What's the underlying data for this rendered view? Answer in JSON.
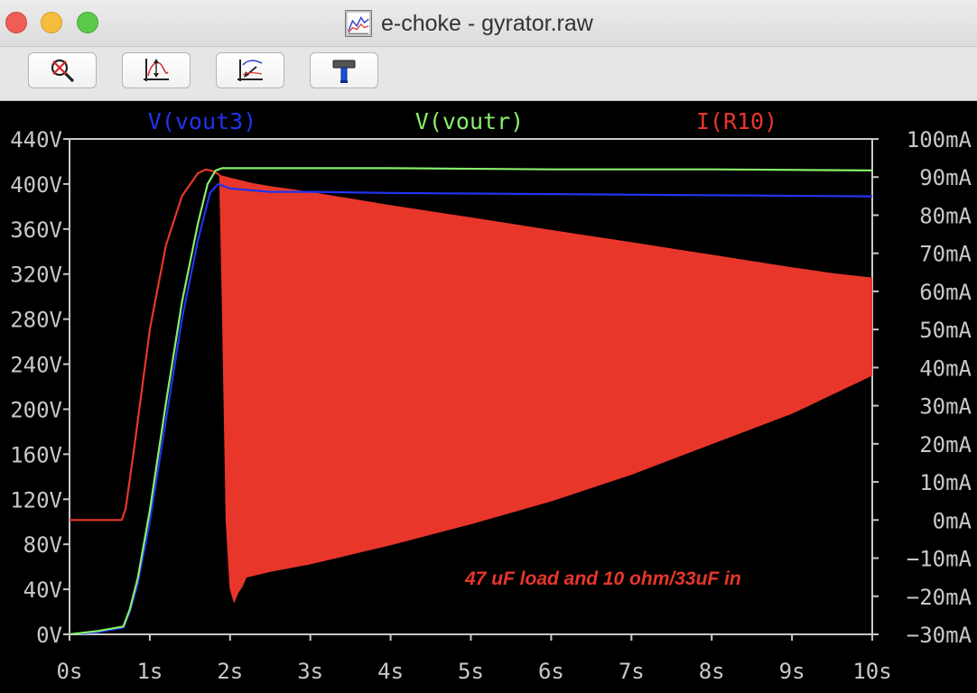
{
  "window": {
    "title": "e-choke - gyrator.raw",
    "icon": "waveform-file-icon"
  },
  "toolbar": {
    "buttons": [
      {
        "name": "zoom-cancel",
        "icon": "magnifier-cross-icon"
      },
      {
        "name": "autorange",
        "icon": "autorange-axes-icon"
      },
      {
        "name": "zoom-back",
        "icon": "zoom-back-arrow-icon"
      },
      {
        "name": "tools",
        "icon": "hammer-icon"
      }
    ]
  },
  "colors": {
    "background": "#000000",
    "axis": "#c8c8c8",
    "vout3": "#2233ee",
    "voutr": "#88f06a",
    "ir10": "#e8362b"
  },
  "chart_data": {
    "type": "line",
    "title": "",
    "xlabel": "",
    "xlim": [
      0,
      10
    ],
    "x_ticks": [
      {
        "v": 0,
        "label": "0s"
      },
      {
        "v": 1,
        "label": "1s"
      },
      {
        "v": 2,
        "label": "2s"
      },
      {
        "v": 3,
        "label": "3s"
      },
      {
        "v": 4,
        "label": "4s"
      },
      {
        "v": 5,
        "label": "5s"
      },
      {
        "v": 6,
        "label": "6s"
      },
      {
        "v": 7,
        "label": "7s"
      },
      {
        "v": 8,
        "label": "8s"
      },
      {
        "v": 9,
        "label": "9s"
      },
      {
        "v": 10,
        "label": "10s"
      }
    ],
    "y_left": {
      "ylim": [
        0,
        440
      ],
      "ticks": [
        {
          "v": 440,
          "label": "440V"
        },
        {
          "v": 400,
          "label": "400V"
        },
        {
          "v": 360,
          "label": "360V"
        },
        {
          "v": 320,
          "label": "320V"
        },
        {
          "v": 280,
          "label": "280V"
        },
        {
          "v": 240,
          "label": "240V"
        },
        {
          "v": 200,
          "label": "200V"
        },
        {
          "v": 160,
          "label": "160V"
        },
        {
          "v": 120,
          "label": "120V"
        },
        {
          "v": 80,
          "label": "80V"
        },
        {
          "v": 40,
          "label": "40V"
        },
        {
          "v": 0,
          "label": "0V"
        }
      ]
    },
    "y_right": {
      "ylim": [
        -30,
        100
      ],
      "ticks": [
        {
          "v": 100,
          "label": "100mA"
        },
        {
          "v": 90,
          "label": "90mA"
        },
        {
          "v": 80,
          "label": "80mA"
        },
        {
          "v": 70,
          "label": "70mA"
        },
        {
          "v": 60,
          "label": "60mA"
        },
        {
          "v": 50,
          "label": "50mA"
        },
        {
          "v": 40,
          "label": "40mA"
        },
        {
          "v": 30,
          "label": "30mA"
        },
        {
          "v": 20,
          "label": "20mA"
        },
        {
          "v": 10,
          "label": "10mA"
        },
        {
          "v": 0,
          "label": "0mA"
        },
        {
          "v": -10,
          "label": "−10mA"
        },
        {
          "v": -20,
          "label": "−20mA"
        },
        {
          "v": -30,
          "label": "−30mA"
        }
      ]
    },
    "series": [
      {
        "name": "V(vout3)",
        "axis": "left",
        "color": "#2233ee",
        "x": [
          0,
          0.35,
          0.67,
          0.75,
          0.85,
          1.0,
          1.2,
          1.4,
          1.6,
          1.75,
          1.85,
          2.0,
          2.5,
          3,
          4,
          6,
          8,
          10
        ],
        "y": [
          0,
          2,
          6,
          20,
          45,
          100,
          190,
          280,
          350,
          392,
          400,
          396,
          393,
          393,
          392,
          391,
          390,
          389
        ]
      },
      {
        "name": "V(voutr)",
        "axis": "left",
        "color": "#88f06a",
        "x": [
          0,
          0.35,
          0.67,
          0.75,
          0.85,
          1.0,
          1.2,
          1.4,
          1.6,
          1.72,
          1.82,
          1.9,
          2.0,
          2.5,
          3,
          4,
          6,
          8,
          10
        ],
        "y": [
          0,
          3,
          7,
          22,
          50,
          110,
          205,
          295,
          365,
          400,
          412,
          414,
          414,
          414,
          414,
          414,
          413,
          413,
          412
        ]
      },
      {
        "name": "I(R10)",
        "axis": "right",
        "color": "#e8362b",
        "x": [
          0,
          0.65,
          0.7,
          0.8,
          1.0,
          1.2,
          1.4,
          1.6,
          1.7,
          1.8,
          1.87
        ],
        "y": [
          0,
          0,
          3,
          18,
          50,
          72,
          85,
          91,
          92,
          91.5,
          90.5
        ],
        "envelope": {
          "x": [
            1.87,
            1.9,
            1.95,
            2.0,
            2.05,
            2.1,
            2.15,
            2.2,
            2.3,
            2.5,
            3,
            4,
            5,
            6,
            7,
            8,
            9,
            9.5,
            10
          ],
          "upper": [
            90.5,
            90.3,
            90,
            89.7,
            89.5,
            89.2,
            89,
            88.7,
            88.2,
            87.5,
            86,
            82.5,
            79.3,
            76,
            72.8,
            69.5,
            66.2,
            64.7,
            63.5
          ],
          "lower": [
            90.5,
            60,
            0,
            -18,
            -21.5,
            -19,
            -17.5,
            -15,
            -14.5,
            -13.5,
            -11.5,
            -6.5,
            -1,
            5,
            12,
            20,
            28,
            33,
            38
          ]
        }
      }
    ],
    "annotation": {
      "text": "47 uF load and 10 ohm/33uF in",
      "color": "#e8362b"
    }
  }
}
